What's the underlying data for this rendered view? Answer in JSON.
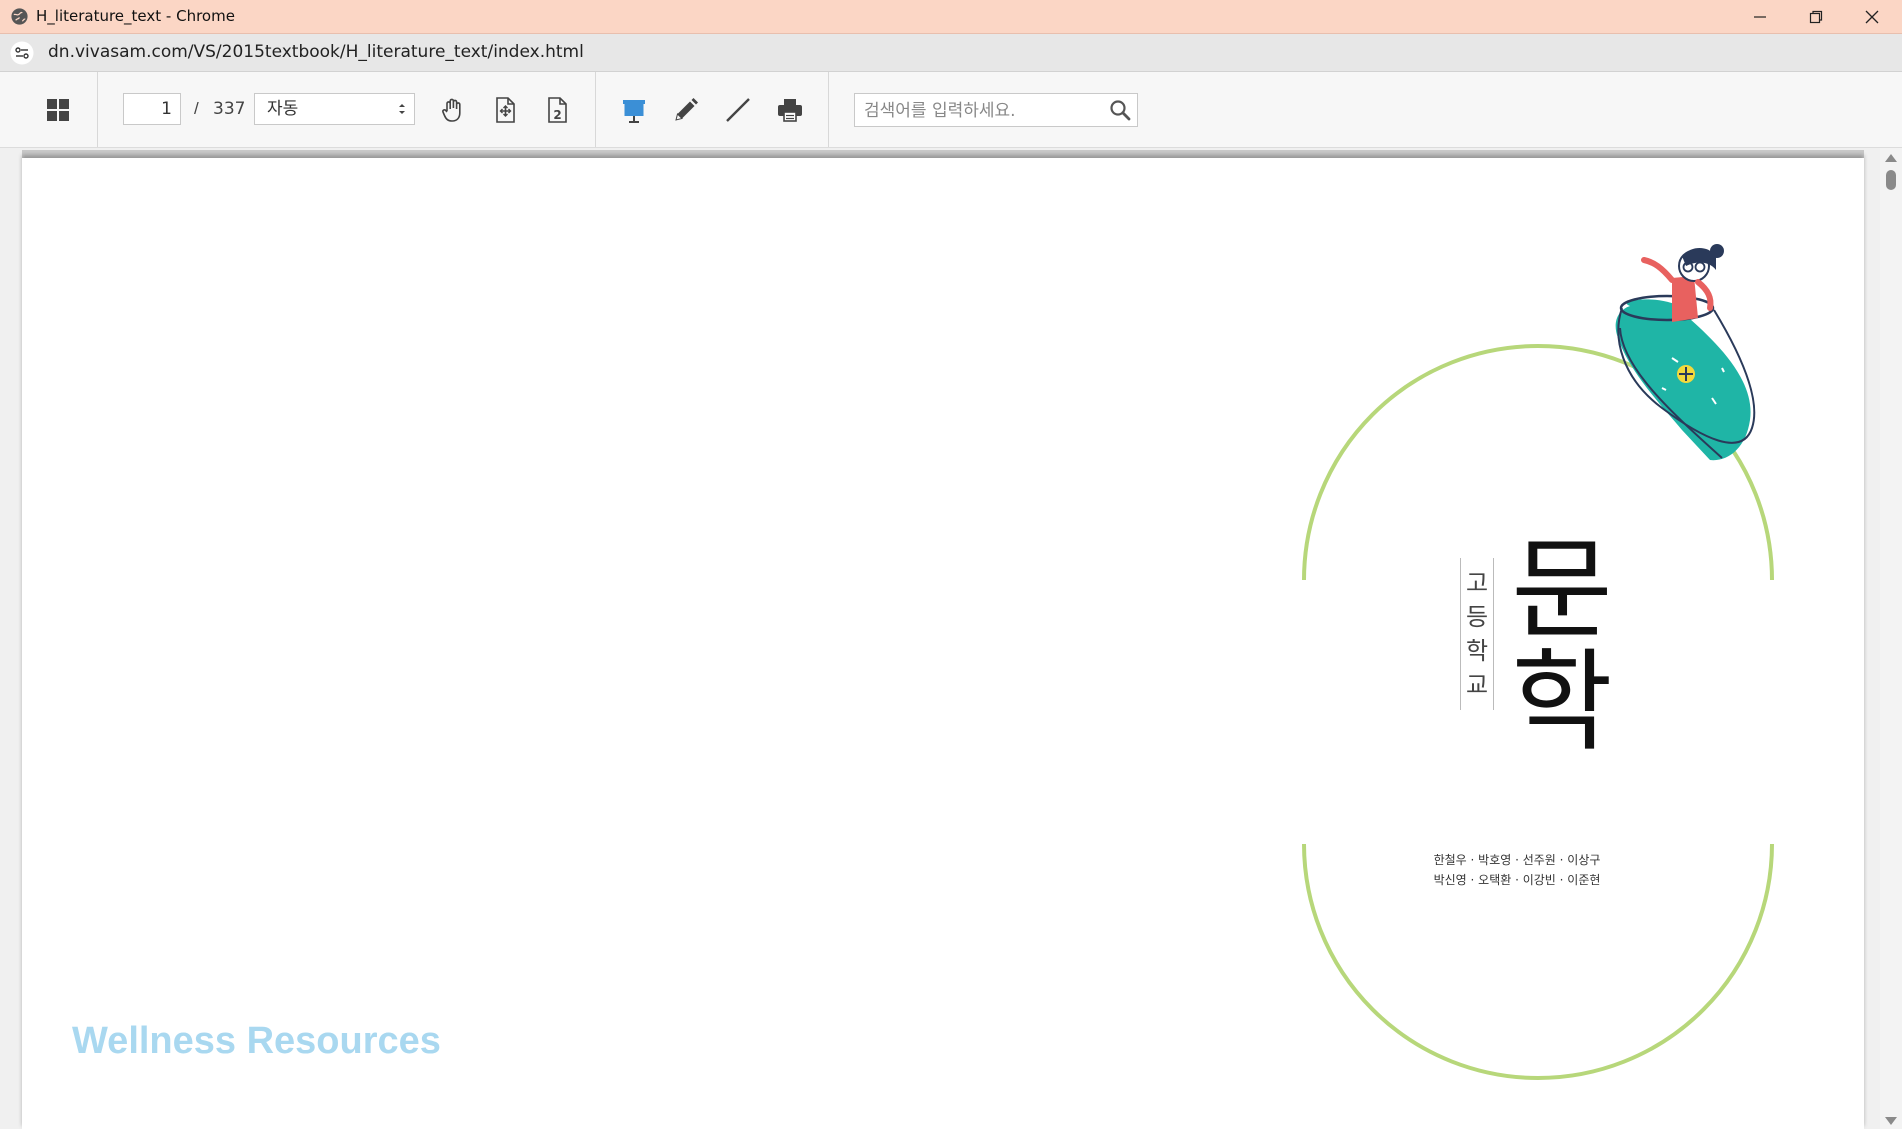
{
  "window": {
    "title": "H_literature_text - Chrome",
    "url": "dn.vivasam.com/VS/2015textbook/H_literature_text/index.html"
  },
  "toolbar": {
    "current_page": "1",
    "separator": "/",
    "total_pages": "337",
    "zoom_value": "자동",
    "search_placeholder": "검색어를 입력하세요."
  },
  "cover": {
    "subtitle_chars": [
      "고",
      "등",
      "학",
      "교"
    ],
    "title_chars": [
      "문",
      "학"
    ],
    "authors_line1": "한철우 · 박호영 · 선주원 · 이상구",
    "authors_line2": "박신영 · 오택환 · 이강빈 · 이준현"
  },
  "watermark": "Wellness Resources",
  "colors": {
    "titlebar": "#fbd6c5",
    "circle": "#b7d77a",
    "watermark": "#a9d8f0",
    "accent_blue": "#3b8fd6"
  }
}
